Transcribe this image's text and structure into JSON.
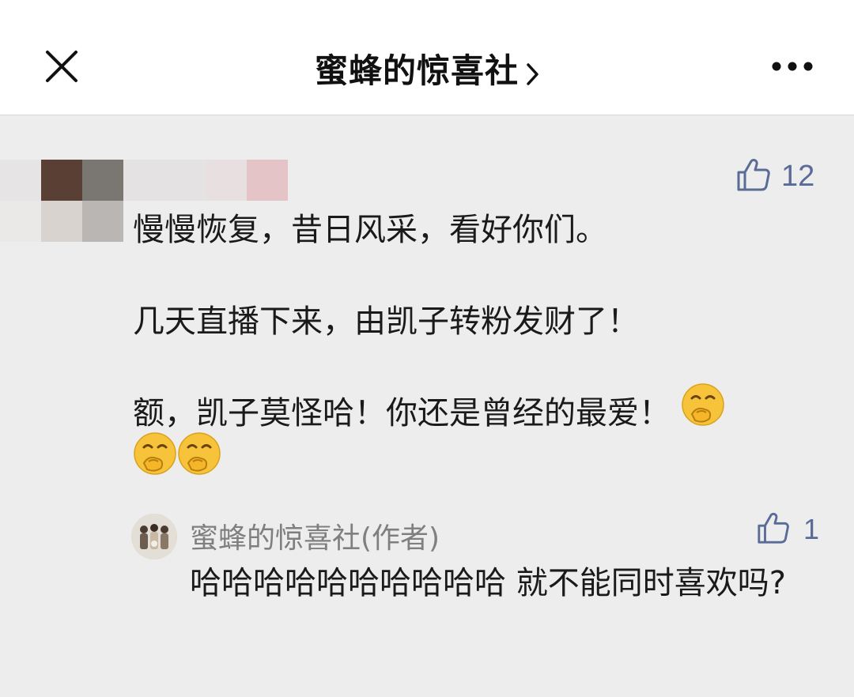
{
  "header": {
    "title": "蜜蜂的惊喜社",
    "close_icon": "close-icon",
    "more_icon": "more-dots-icon"
  },
  "comment": {
    "likes": "12",
    "lines": [
      "慢慢恢复，昔日风采，看好你们。",
      "几天直播下来，由凯子转粉发财了！",
      "额，凯子莫怪哈！你还是曾经的最爱！"
    ],
    "emoji": "covering-mouth-laugh-emoji"
  },
  "reply": {
    "author": "蜜蜂的惊喜社(作者)",
    "likes": "1",
    "text": "哈哈哈哈哈哈哈哈哈哈  就不能同时喜欢吗?"
  },
  "colors": {
    "like_blue": "#5a6b97",
    "header_bg": "#ffffff",
    "content_bg": "#ededed"
  }
}
